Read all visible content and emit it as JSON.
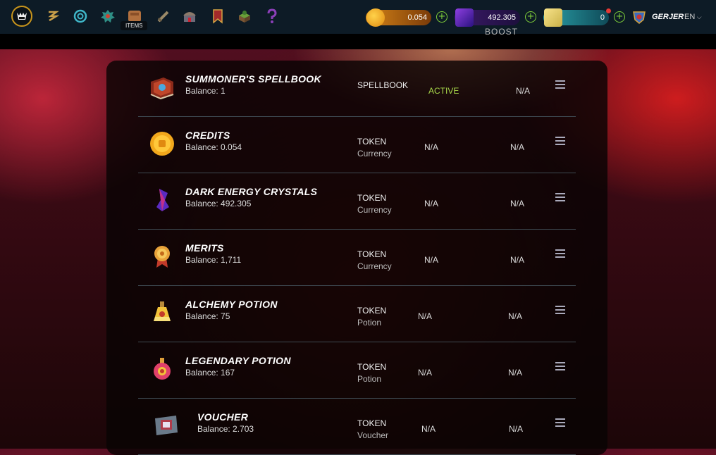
{
  "nav": {
    "tooltip": "ITEMS",
    "icons": [
      "splinterlands-logo-icon",
      "quest-icon",
      "portal-icon",
      "guild-icon",
      "items-icon",
      "battle-icon",
      "shop-icon",
      "banner-icon",
      "land-icon",
      "help-icon"
    ]
  },
  "resources": {
    "credits": "0.054",
    "dec": "492.305",
    "vouchers": "0"
  },
  "user": {
    "name": "GERJER",
    "lang": "EN"
  },
  "subheader": {
    "boost": "BOOST"
  },
  "items": [
    {
      "name": "SUMMONER'S SPELLBOOK",
      "balance": "Balance: 1",
      "type": "SPELLBOOK",
      "sub": "",
      "col1": "ACTIVE",
      "col2": "N/A",
      "icon": "spellbook-icon"
    },
    {
      "name": "CREDITS",
      "balance": "Balance: 0.054",
      "type": "TOKEN",
      "sub": "Currency",
      "col1": "N/A",
      "col2": "N/A",
      "icon": "credits-icon"
    },
    {
      "name": "DARK ENERGY CRYSTALS",
      "balance": "Balance: 492.305",
      "type": "TOKEN",
      "sub": "Currency",
      "col1": "N/A",
      "col2": "N/A",
      "icon": "dec-crystal-icon"
    },
    {
      "name": "MERITS",
      "balance": "Balance: 1,711",
      "type": "TOKEN",
      "sub": "Currency",
      "col1": "N/A",
      "col2": "N/A",
      "icon": "merits-icon"
    },
    {
      "name": "ALCHEMY POTION",
      "balance": "Balance: 75",
      "type": "TOKEN",
      "sub": "Potion",
      "col1": "N/A",
      "col2": "N/A",
      "icon": "alchemy-potion-icon"
    },
    {
      "name": "LEGENDARY POTION",
      "balance": "Balance: 167",
      "type": "TOKEN",
      "sub": "Potion",
      "col1": "N/A",
      "col2": "N/A",
      "icon": "legendary-potion-icon"
    },
    {
      "name": "VOUCHER",
      "balance": "Balance: 2.703",
      "type": "TOKEN",
      "sub": "Voucher",
      "col1": "N/A",
      "col2": "N/A",
      "icon": "voucher-icon"
    }
  ]
}
